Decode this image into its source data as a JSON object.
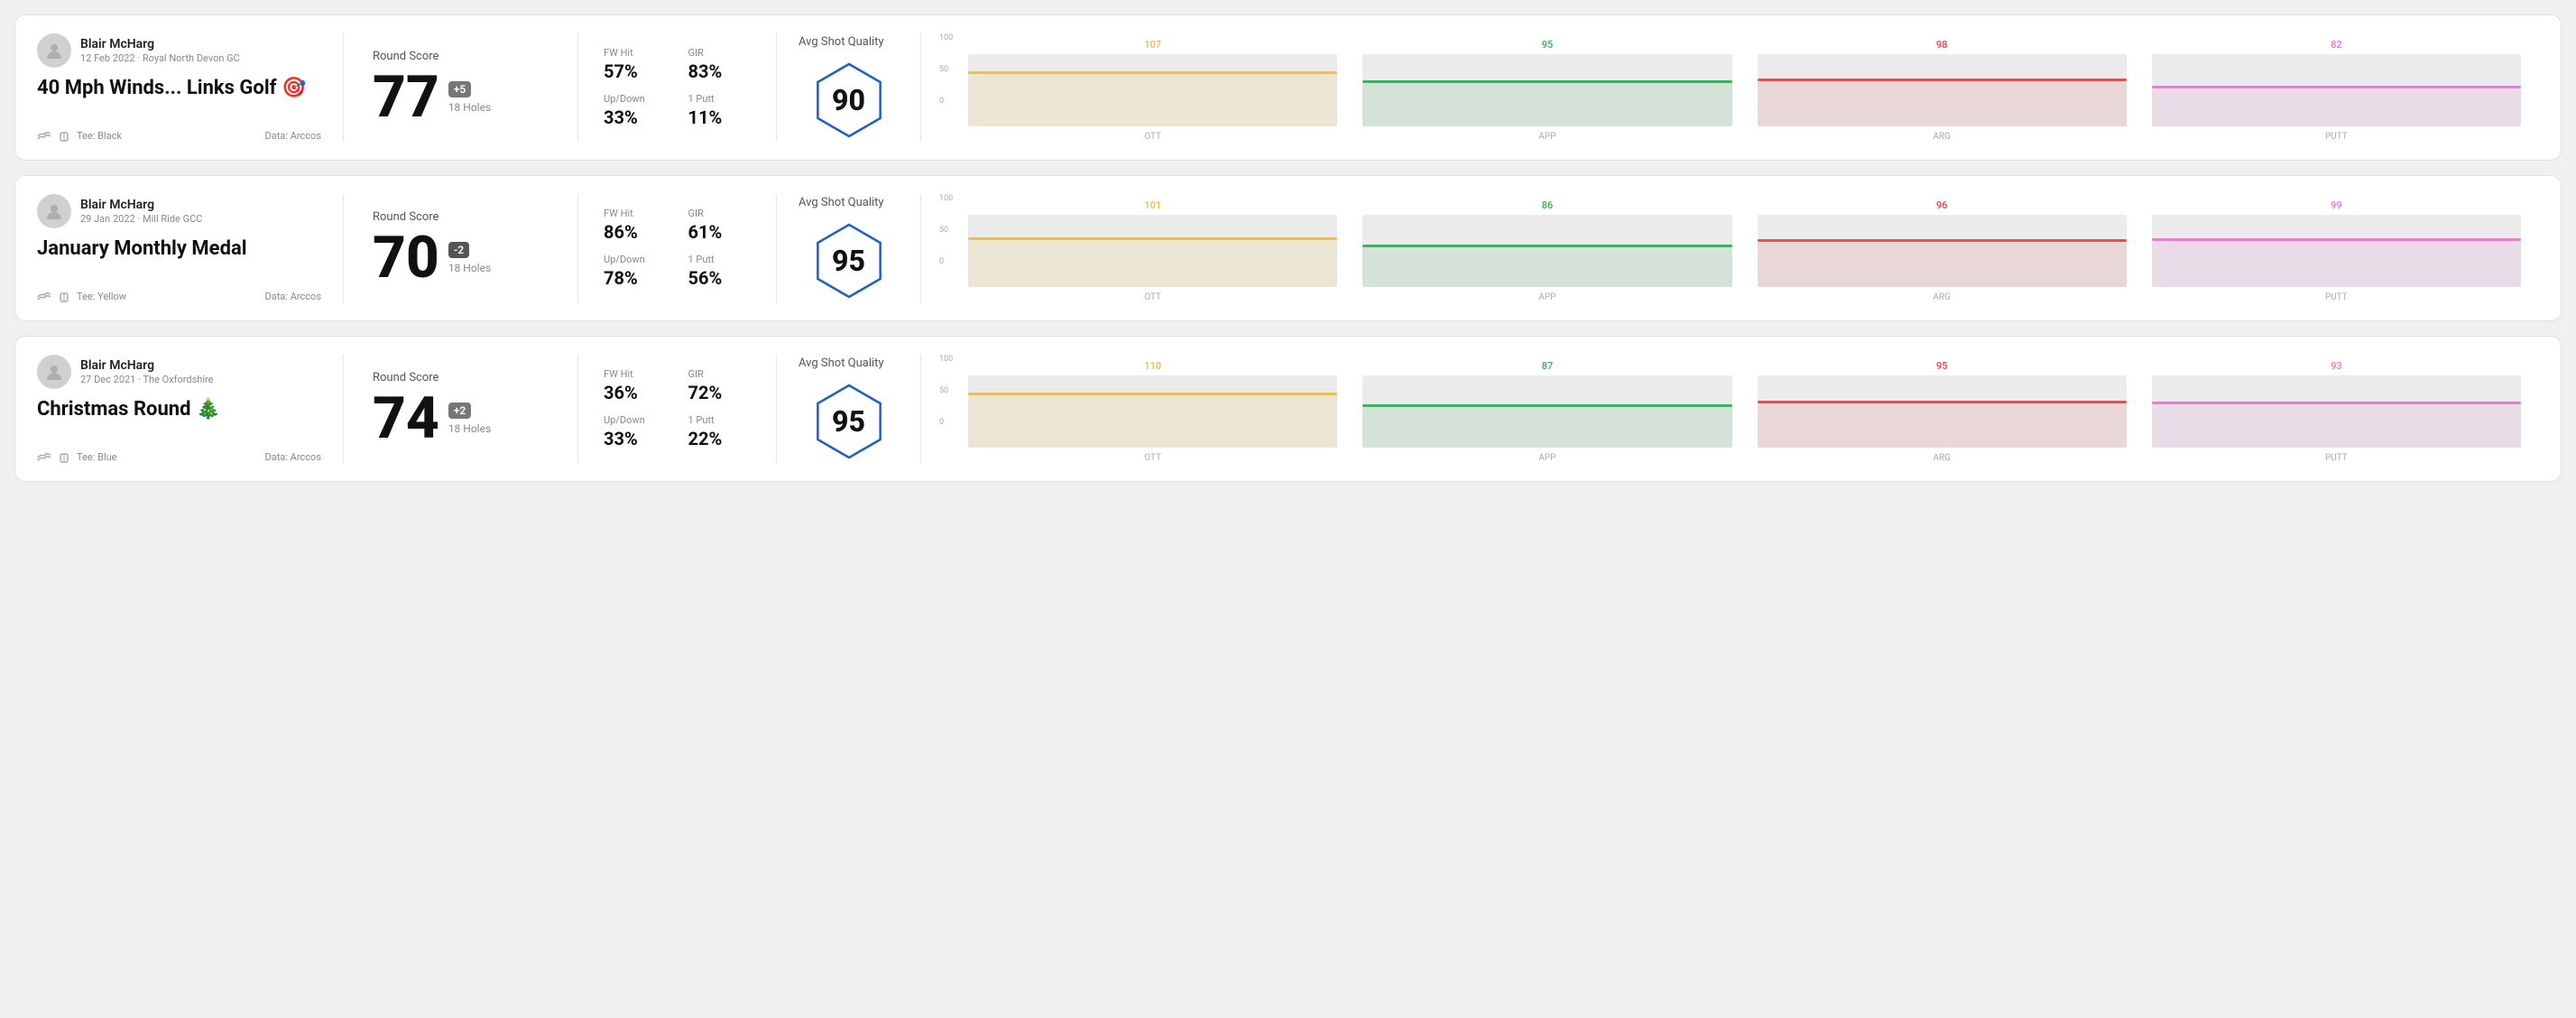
{
  "rounds": [
    {
      "id": "round1",
      "user": {
        "name": "Blair McHarg",
        "date_course": "12 Feb 2022 · Royal North Devon GC"
      },
      "title": "40 Mph Winds... Links Golf 🎯",
      "tee": "Black",
      "data_source": "Data: Arccos",
      "score": "77",
      "score_diff": "+5",
      "score_diff_type": "over",
      "holes": "18 Holes",
      "fw_hit": "57%",
      "gir": "83%",
      "up_down": "33%",
      "one_putt": "11%",
      "avg_quality": "90",
      "chart": {
        "ott": {
          "value": 107,
          "color": "#f0c040",
          "bar_pct": 72
        },
        "app": {
          "value": 95,
          "color": "#40b060",
          "bar_pct": 60
        },
        "arg": {
          "value": 98,
          "color": "#e05050",
          "bar_pct": 63
        },
        "putt": {
          "value": 82,
          "color": "#e080d0",
          "bar_pct": 52
        }
      }
    },
    {
      "id": "round2",
      "user": {
        "name": "Blair McHarg",
        "date_course": "29 Jan 2022 · Mill Ride GCC"
      },
      "title": "January Monthly Medal",
      "tee": "Yellow",
      "data_source": "Data: Arccos",
      "score": "70",
      "score_diff": "-2",
      "score_diff_type": "under",
      "holes": "18 Holes",
      "fw_hit": "86%",
      "gir": "61%",
      "up_down": "78%",
      "one_putt": "56%",
      "avg_quality": "95",
      "chart": {
        "ott": {
          "value": 101,
          "color": "#f0c040",
          "bar_pct": 65
        },
        "app": {
          "value": 86,
          "color": "#40b060",
          "bar_pct": 55
        },
        "arg": {
          "value": 96,
          "color": "#e05050",
          "bar_pct": 62
        },
        "putt": {
          "value": 99,
          "color": "#e080d0",
          "bar_pct": 64
        }
      }
    },
    {
      "id": "round3",
      "user": {
        "name": "Blair McHarg",
        "date_course": "27 Dec 2021 · The Oxfordshire"
      },
      "title": "Christmas Round 🎄",
      "tee": "Blue",
      "data_source": "Data: Arccos",
      "score": "74",
      "score_diff": "+2",
      "score_diff_type": "over",
      "holes": "18 Holes",
      "fw_hit": "36%",
      "gir": "72%",
      "up_down": "33%",
      "one_putt": "22%",
      "avg_quality": "95",
      "chart": {
        "ott": {
          "value": 110,
          "color": "#f0c040",
          "bar_pct": 72
        },
        "app": {
          "value": 87,
          "color": "#40b060",
          "bar_pct": 56
        },
        "arg": {
          "value": 95,
          "color": "#e05050",
          "bar_pct": 61
        },
        "putt": {
          "value": 93,
          "color": "#e080d0",
          "bar_pct": 60
        }
      }
    }
  ],
  "labels": {
    "round_score": "Round Score",
    "fw_hit": "FW Hit",
    "gir": "GIR",
    "up_down": "Up/Down",
    "one_putt": "1 Putt",
    "avg_quality": "Avg Shot Quality",
    "tee_prefix": "Tee:",
    "ott": "OTT",
    "app": "APP",
    "arg": "ARG",
    "putt": "PUTT",
    "axis_100": "100",
    "axis_50": "50",
    "axis_0": "0"
  }
}
